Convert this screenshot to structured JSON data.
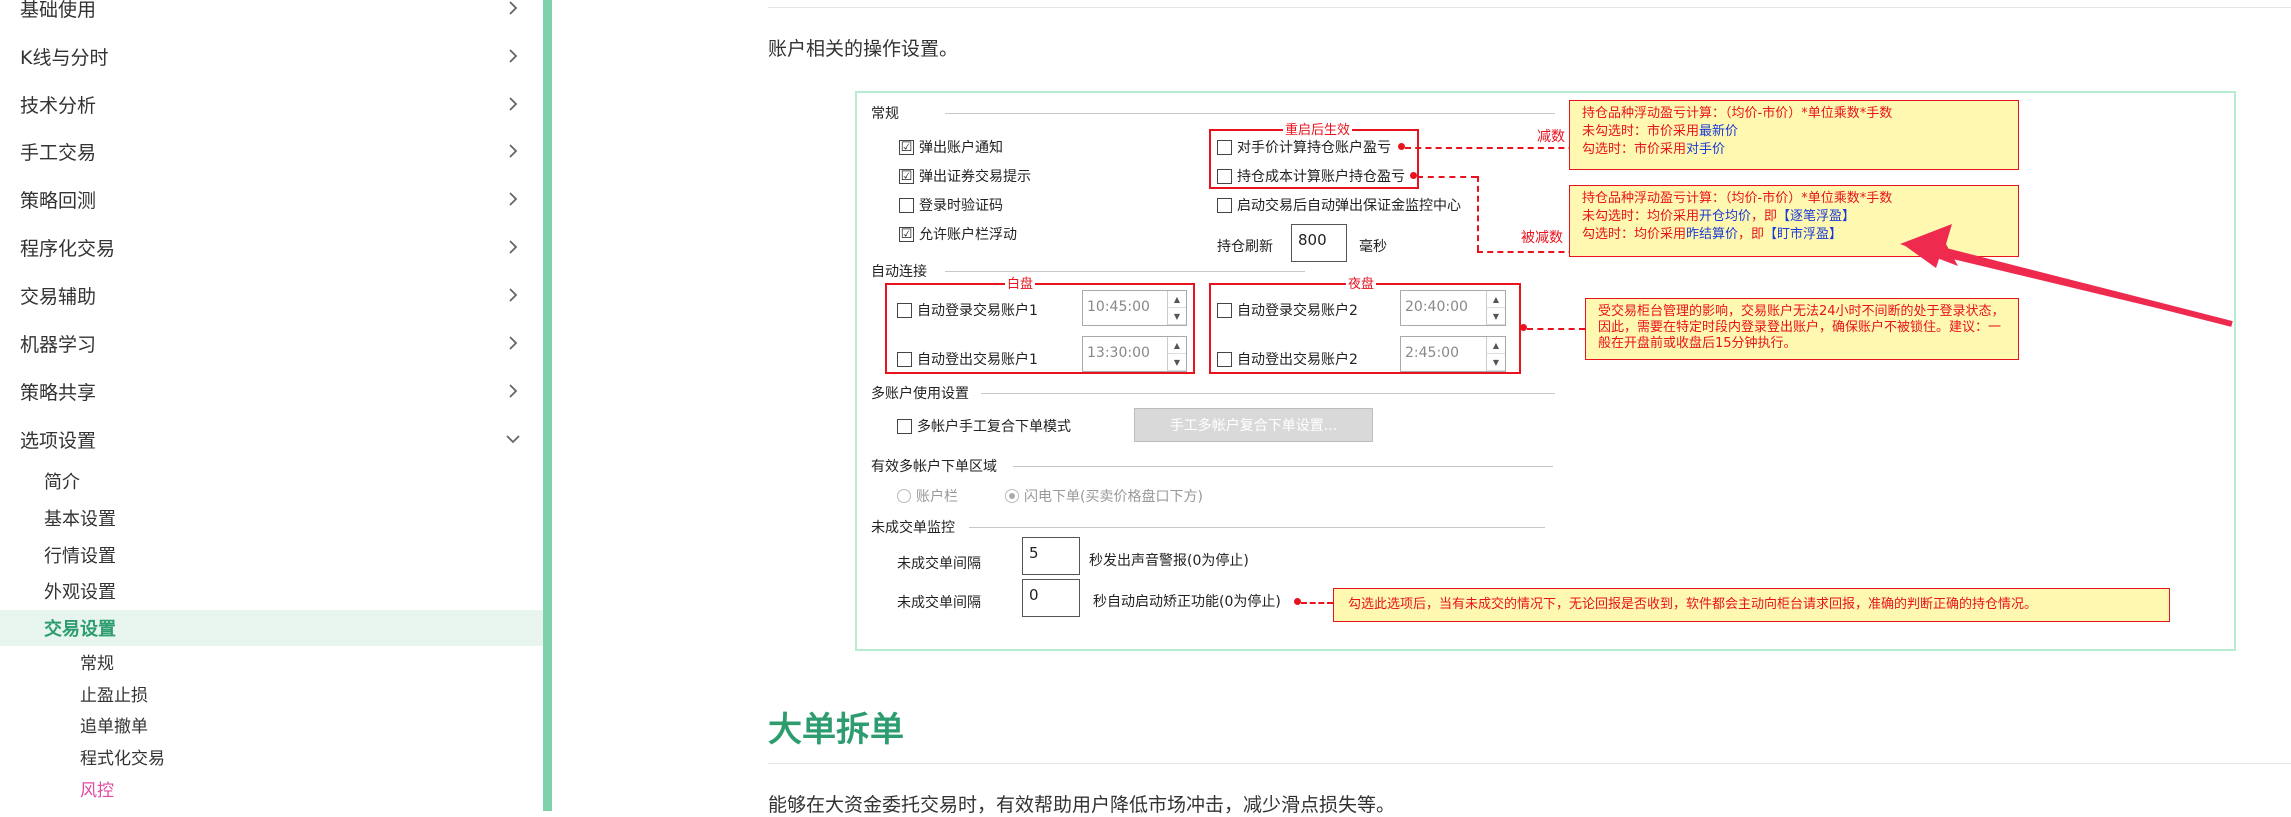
{
  "sidebar": {
    "items": [
      {
        "label": "基础使用"
      },
      {
        "label": "K线与分时"
      },
      {
        "label": "技术分析"
      },
      {
        "label": "手工交易"
      },
      {
        "label": "策略回测"
      },
      {
        "label": "程序化交易"
      },
      {
        "label": "交易辅助"
      },
      {
        "label": "机器学习"
      },
      {
        "label": "策略共享"
      },
      {
        "label": "选项设置"
      }
    ],
    "sub_items": [
      {
        "label": "简介"
      },
      {
        "label": "基本设置"
      },
      {
        "label": "行情设置"
      },
      {
        "label": "外观设置"
      },
      {
        "label": "交易设置"
      }
    ],
    "sub2_items": [
      {
        "label": "常规"
      },
      {
        "label": "止盈止损"
      },
      {
        "label": "追单撤单"
      },
      {
        "label": "程式化交易"
      },
      {
        "label": "风控"
      }
    ],
    "accent_color": "#7fd1ac",
    "active_color": "#2d9d6f",
    "current_color": "#e04aa0"
  },
  "main": {
    "intro": "账户相关的操作设置。",
    "section_title": "大单拆单",
    "section_para": "能够在大资金委托交易时，有效帮助用户降低市场冲击，减少滑点损失等。"
  },
  "shot": {
    "general": {
      "title": "常规",
      "left_checks": [
        {
          "label": "弹出账户通知",
          "checked": "☑"
        },
        {
          "label": "弹出证券交易提示",
          "checked": "☑"
        },
        {
          "label": "登录时验证码",
          "checked": ""
        },
        {
          "label": "允许账户栏浮动",
          "checked": "☑"
        }
      ],
      "restart_label": "重启后生效",
      "right_checks": [
        {
          "label": "对手价计算持仓账户盈亏",
          "checked": ""
        },
        {
          "label": "持仓成本计算账户持仓盈亏",
          "checked": ""
        },
        {
          "label": "启动交易后自动弹出保证金监控中心",
          "checked": ""
        }
      ],
      "refresh_label": "持仓刷新",
      "refresh_value": "800",
      "refresh_unit": "毫秒"
    },
    "auto_connect": {
      "title": "自动连接",
      "day_label": "白盘",
      "night_label": "夜盘",
      "day": [
        {
          "label": "自动登录交易账户1",
          "time": "10:45:00"
        },
        {
          "label": "自动登出交易账户1",
          "time": "13:30:00"
        }
      ],
      "night": [
        {
          "label": "自动登录交易账户2",
          "time": "20:40:00"
        },
        {
          "label": "自动登出交易账户2",
          "time": "2:45:00"
        }
      ]
    },
    "multi": {
      "title": "多账户使用设置",
      "check_label": "多帐户手工复合下单模式",
      "button_label": "手工多帐户复合下单设置..."
    },
    "valid_area": {
      "title": "有效多帐户下单区域",
      "opt1": "账户栏",
      "opt2": "闪电下单(买卖价格盘口下方)"
    },
    "unfilled": {
      "title": "未成交单监控",
      "row1_label": "未成交单间隔",
      "row1_value": "5",
      "row1_suffix": "秒发出声音警报(0为停止)",
      "row2_label": "未成交单间隔",
      "row2_value": "0",
      "row2_suffix": "秒自动启动矫正功能(0为停止)"
    },
    "annotations": {
      "jiancha": "减数",
      "beijiancha": "被减数",
      "note1": {
        "line1": "持仓品种浮动盈亏计算：（均价-市价）*单位乘数*手数",
        "line2a": "未勾选时：市价采用",
        "line2b": "最新价",
        "line3a": "勾选时：市价采用",
        "line3b": "对手价"
      },
      "note2": {
        "line1": "持仓品种浮动盈亏计算：（均价-市价）*单位乘数*手数",
        "line2a": "未勾选时：均价采用",
        "line2b": "开仓均价",
        "line2c": "，即",
        "line2d": "【逐笔浮盈】",
        "line3a": "勾选时：均价采用",
        "line3b": "昨结算价",
        "line3c": "，即",
        "line3d": "【盯市浮盈】"
      },
      "note3": "受交易柜台管理的影响，交易账户无法24小时不间断的处于登录状态，因此，需要在特定时段内登录登出账户，确保账户不被锁住。建议：一般在开盘前或收盘后15分钟执行。",
      "note4": "勾选此选项后，当有未成交的情况下，无论回报是否收到，软件都会主动向柜台请求回报，准确的判断正确的持仓情况。"
    }
  }
}
